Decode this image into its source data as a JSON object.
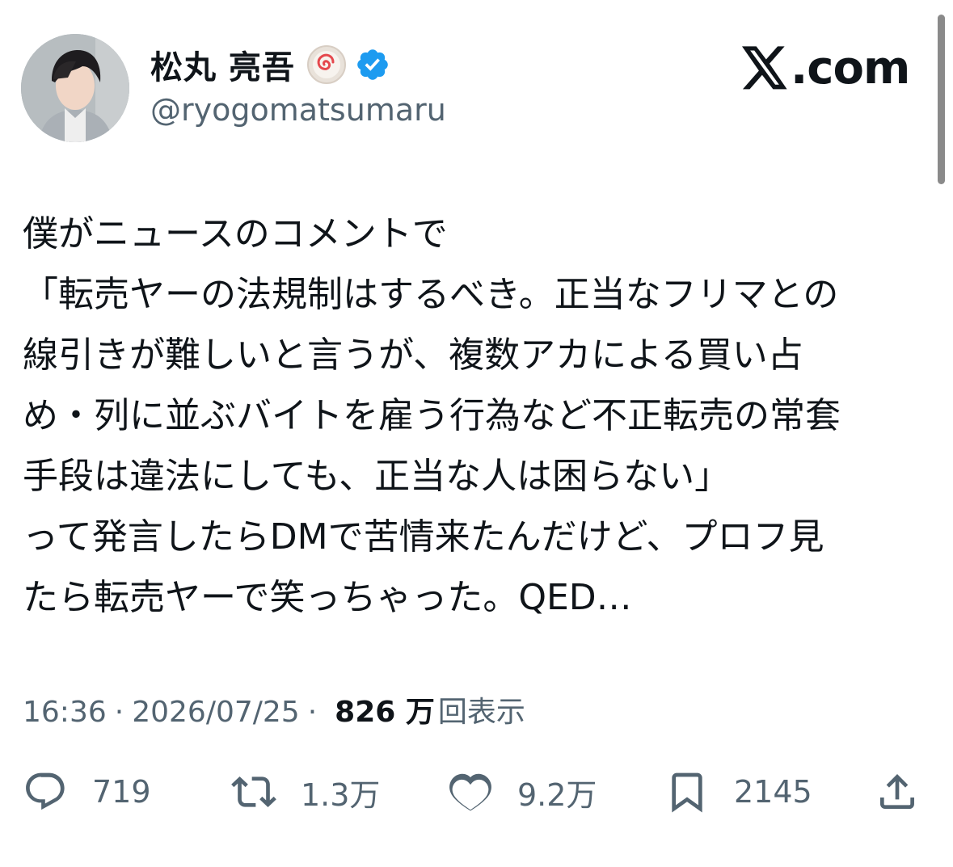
{
  "header": {
    "display_name": "松丸 亮吾",
    "handle": "@ryogomatsumaru",
    "site": "com"
  },
  "tweet": {
    "lines": [
      "僕がニュースのコメントで",
      "「転売ヤーの法規制はするべき。正当なフリマとの",
      "線引きが難しいと言うが、複数アカによる買い占",
      "め・列に並ぶバイトを雇う行為など不正転売の常套",
      "手段は違法にしても、正当な人は困らない」",
      "って発言したらDMで苦情来たんだけど、プロフ見",
      "たら転売ヤーで笑っちゃった。QED…"
    ]
  },
  "meta": {
    "time": "16:36",
    "separator": "·",
    "date": "2026/07/25",
    "views_count": "826 万",
    "views_label": "回表示"
  },
  "actions": {
    "reply_count": "719",
    "retweet_count": "1.3万",
    "like_count": "9.2万",
    "bookmark_count": "2145"
  },
  "icons": {
    "reply": "reply-icon",
    "retweet": "retweet-icon",
    "like": "like-icon",
    "bookmark": "bookmark-icon",
    "share": "share-icon",
    "verified": "verified-badge-icon"
  },
  "colors": {
    "text": "#0f1419",
    "secondary": "#536471",
    "verified": "#1d9bf0"
  }
}
